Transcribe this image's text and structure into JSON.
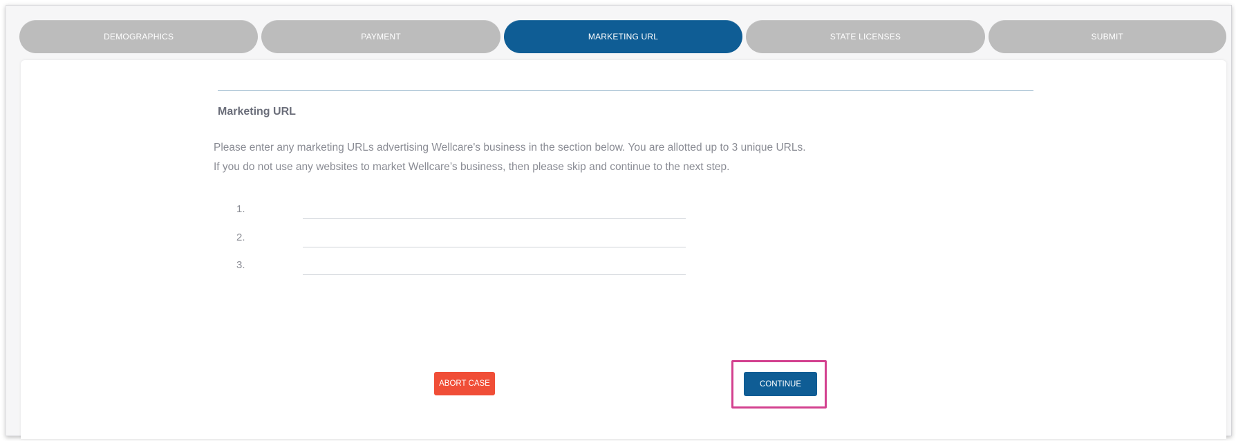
{
  "steps": [
    {
      "label": "DEMOGRAPHICS",
      "active": false
    },
    {
      "label": "PAYMENT",
      "active": false
    },
    {
      "label": "MARKETING URL",
      "active": true
    },
    {
      "label": "STATE LICENSES",
      "active": false
    },
    {
      "label": "SUBMIT",
      "active": false
    }
  ],
  "section": {
    "title": "Marketing URL",
    "description_line1": "Please enter any marketing URLs advertising Wellcare's business in the section below. You are allotted up to 3 unique URLs.",
    "description_line2": "If you do not use any websites to market Wellcare’s business, then please skip and continue to the next step."
  },
  "url_fields": [
    {
      "number": "1.",
      "value": ""
    },
    {
      "number": "2.",
      "value": ""
    },
    {
      "number": "3.",
      "value": ""
    }
  ],
  "actions": {
    "abort_label": "ABORT CASE",
    "continue_label": "CONTINUE"
  },
  "colors": {
    "active_step": "#0f5d95",
    "inactive_step": "#bcbcbc",
    "abort_button": "#f04e37",
    "continue_button": "#0f5d95",
    "highlight": "#d3418f"
  }
}
